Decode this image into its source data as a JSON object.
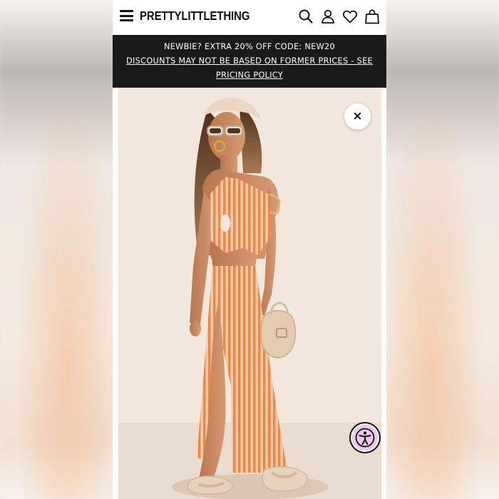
{
  "header": {
    "logo": "PRETTYLITTLETHING",
    "icons": [
      "menu-icon",
      "search-icon",
      "account-icon",
      "wishlist-heart-icon",
      "shopping-bag-icon"
    ]
  },
  "promo": {
    "line1": "NEWBIE? EXTRA 20% OFF CODE: NEW20",
    "line2": "DISCOUNTS MAY NOT BE BASED ON FORMER PRICES - SEE PRICING POLICY"
  },
  "product_view": {
    "close_label": "×",
    "accessibility_icon": "accessibility-icon"
  },
  "colors": {
    "promo_bg": "#1a1a1a",
    "dress_orange": "#e8945a",
    "accessibility_accent": "#f1c6ec"
  }
}
